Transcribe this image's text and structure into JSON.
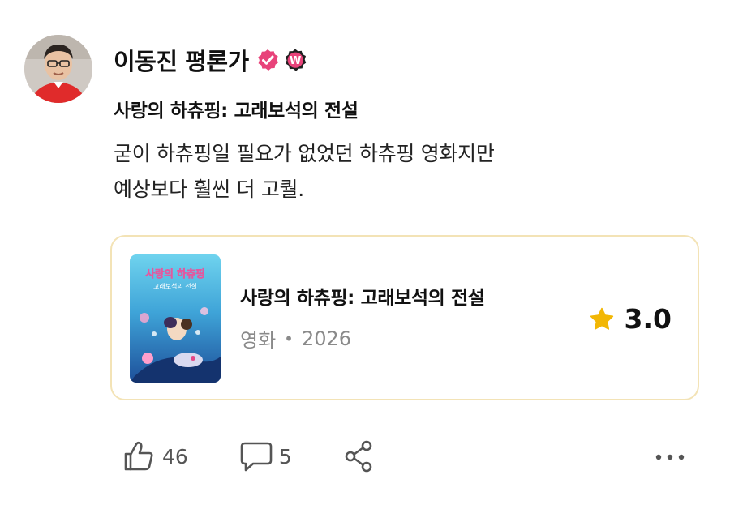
{
  "author": {
    "name": "이동진 평론가",
    "verified_icon": "verified-check-icon",
    "badge_icon": "w-badge-icon",
    "badge_letter": "W",
    "colors": {
      "verified": "#e8437a",
      "badge": "#e8437a"
    }
  },
  "review": {
    "title": "사랑의 하츄핑: 고래보석의 전설",
    "body_lines": [
      "굳이 하츄핑일 필요가 없었던 하츄핑 영화지만",
      "예상보다 훨씬 더 고퀄."
    ]
  },
  "movie_card": {
    "title": "사랑의 하츄핑: 고래보석의 전설",
    "category": "영화",
    "separator": "•",
    "year": "2026",
    "rating": "3.0",
    "star_icon": "star-icon",
    "star_color": "#f2b705",
    "border_color": "#f3e3b6",
    "poster": {
      "title_line1": "사랑의 하츄핑",
      "title_line2": "고래보석의 전설"
    }
  },
  "actions": {
    "like_count": "46",
    "comment_count": "5",
    "like_icon": "thumbs-up-icon",
    "comment_icon": "comment-icon",
    "share_icon": "share-icon",
    "more_icon": "more-dots-icon"
  }
}
